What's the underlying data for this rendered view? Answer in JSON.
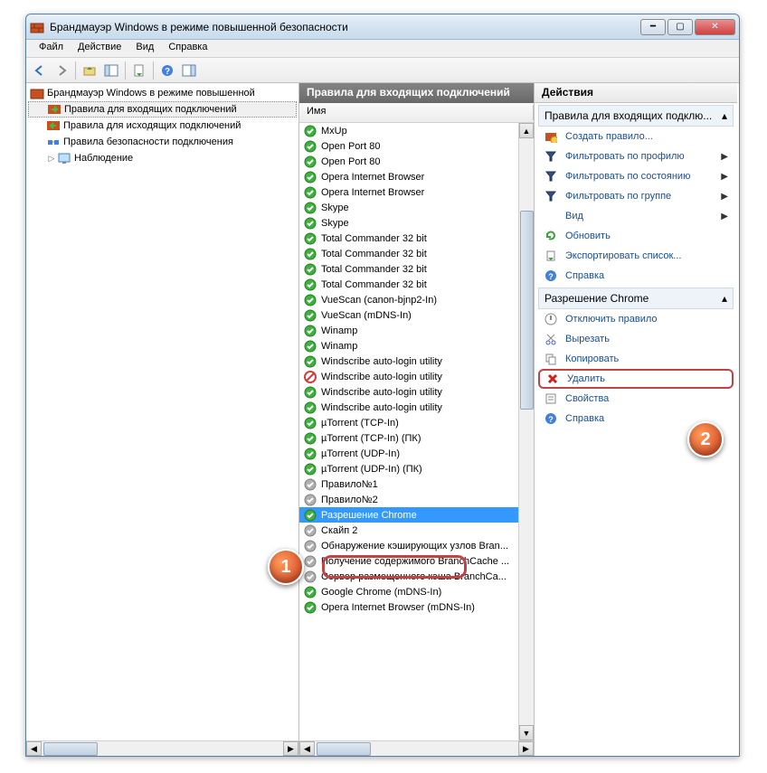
{
  "window": {
    "title": "Брандмауэр Windows в режиме повышенной безопасности"
  },
  "menubar": {
    "items": [
      "Файл",
      "Действие",
      "Вид",
      "Справка"
    ]
  },
  "tree": {
    "root": "Брандмауэр Windows в режиме повышенной",
    "children": [
      "Правила для входящих подключений",
      "Правила для исходящих подключений",
      "Правила безопасности подключения",
      "Наблюдение"
    ]
  },
  "rules": {
    "header": "Правила для входящих подключений",
    "column": "Имя",
    "items": [
      {
        "name": "MxUp",
        "state": "allow"
      },
      {
        "name": "Open Port 80",
        "state": "allow"
      },
      {
        "name": "Open Port 80",
        "state": "allow"
      },
      {
        "name": "Opera Internet Browser",
        "state": "allow"
      },
      {
        "name": "Opera Internet Browser",
        "state": "allow"
      },
      {
        "name": "Skype",
        "state": "allow"
      },
      {
        "name": "Skype",
        "state": "allow"
      },
      {
        "name": "Total Commander 32 bit",
        "state": "allow"
      },
      {
        "name": "Total Commander 32 bit",
        "state": "allow"
      },
      {
        "name": "Total Commander 32 bit",
        "state": "allow"
      },
      {
        "name": "Total Commander 32 bit",
        "state": "allow"
      },
      {
        "name": "VueScan (canon-bjnp2-In)",
        "state": "allow"
      },
      {
        "name": "VueScan (mDNS-In)",
        "state": "allow"
      },
      {
        "name": "Winamp",
        "state": "allow"
      },
      {
        "name": "Winamp",
        "state": "allow"
      },
      {
        "name": "Windscribe auto-login utility",
        "state": "allow"
      },
      {
        "name": "Windscribe auto-login utility",
        "state": "block"
      },
      {
        "name": "Windscribe auto-login utility",
        "state": "allow"
      },
      {
        "name": "Windscribe auto-login utility",
        "state": "allow"
      },
      {
        "name": "µTorrent (TCP-In)",
        "state": "allow"
      },
      {
        "name": "µTorrent (TCP-In) (ПК)",
        "state": "allow"
      },
      {
        "name": "µTorrent (UDP-In)",
        "state": "allow"
      },
      {
        "name": "µTorrent (UDP-In) (ПК)",
        "state": "allow"
      },
      {
        "name": "Правило№1",
        "state": "disabled"
      },
      {
        "name": "Правило№2",
        "state": "disabled"
      },
      {
        "name": "Разрешение Chrome",
        "state": "allow",
        "selected": true
      },
      {
        "name": "Скайп 2",
        "state": "disabled"
      },
      {
        "name": "Обнаружение кэширующих узлов Bran...",
        "state": "disabled"
      },
      {
        "name": "Получение содержимого BranchCache ...",
        "state": "disabled"
      },
      {
        "name": "Сервер размещенного кэша BranchCa...",
        "state": "disabled"
      },
      {
        "name": "Google Chrome (mDNS-In)",
        "state": "allow"
      },
      {
        "name": "Opera Internet Browser (mDNS-In)",
        "state": "allow"
      }
    ]
  },
  "actions": {
    "title": "Действия",
    "section1": {
      "label": "Правила для входящих подклю...",
      "items": [
        {
          "icon": "new-rule",
          "label": "Создать правило..."
        },
        {
          "icon": "filter",
          "label": "Фильтровать по профилю",
          "sub": true
        },
        {
          "icon": "filter",
          "label": "Фильтровать по состоянию",
          "sub": true
        },
        {
          "icon": "filter",
          "label": "Фильтровать по группе",
          "sub": true
        },
        {
          "icon": "blank",
          "label": "Вид",
          "sub": true
        },
        {
          "icon": "refresh",
          "label": "Обновить"
        },
        {
          "icon": "export",
          "label": "Экспортировать список..."
        },
        {
          "icon": "help",
          "label": "Справка"
        }
      ]
    },
    "section2": {
      "label": "Разрешение Chrome",
      "items": [
        {
          "icon": "disable",
          "label": "Отключить правило"
        },
        {
          "icon": "cut",
          "label": "Вырезать"
        },
        {
          "icon": "copy",
          "label": "Копировать"
        },
        {
          "icon": "delete",
          "label": "Удалить",
          "boxed": true
        },
        {
          "icon": "props",
          "label": "Свойства"
        },
        {
          "icon": "help",
          "label": "Справка"
        }
      ]
    }
  },
  "callouts": {
    "c1": "1",
    "c2": "2"
  }
}
